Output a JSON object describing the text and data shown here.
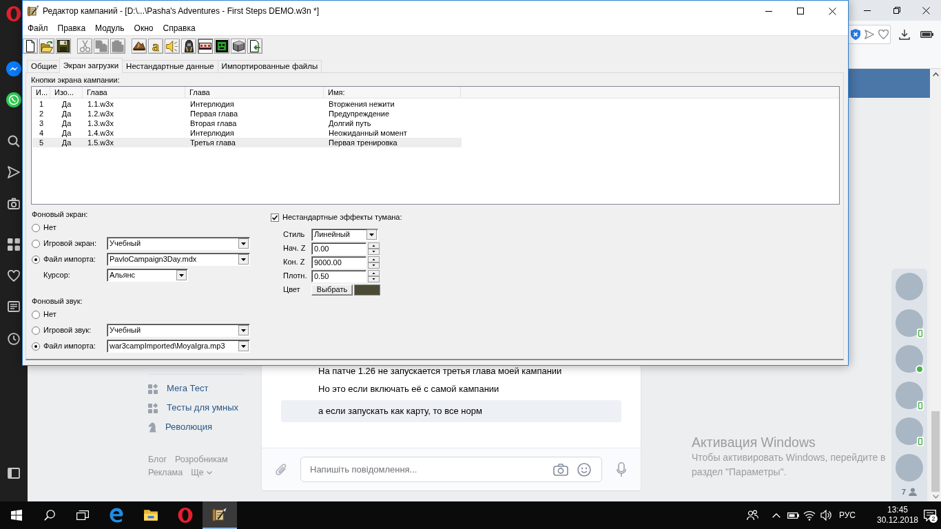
{
  "dialog": {
    "title": "Редактор кампаний - [D:\\...\\Pasha's Adventures - First Steps DEMO.w3n *]",
    "menu": [
      "Файл",
      "Правка",
      "Модуль",
      "Окно",
      "Справка"
    ],
    "toolbar": [
      [
        {
          "kind": "new",
          "disabled": false,
          "pressed": false
        },
        {
          "kind": "open",
          "disabled": false,
          "pressed": false
        },
        {
          "kind": "save",
          "disabled": false,
          "pressed": false
        }
      ],
      [
        {
          "kind": "cut",
          "disabled": true,
          "pressed": false
        },
        {
          "kind": "copy",
          "disabled": true,
          "pressed": false
        },
        {
          "kind": "paste",
          "disabled": true,
          "pressed": false
        }
      ],
      [
        {
          "kind": "terrain",
          "disabled": false,
          "pressed": false
        },
        {
          "kind": "glyph",
          "glyph": "a",
          "disabled": false,
          "pressed": false
        },
        {
          "kind": "sound",
          "disabled": false,
          "pressed": false
        },
        {
          "kind": "unit",
          "disabled": false,
          "pressed": false
        },
        {
          "kind": "screen",
          "disabled": false,
          "pressed": true
        },
        {
          "kind": "mask",
          "disabled": false,
          "pressed": false
        },
        {
          "kind": "cube",
          "disabled": false,
          "pressed": false
        },
        {
          "kind": "import",
          "disabled": false,
          "pressed": false
        }
      ]
    ],
    "tabs": [
      {
        "label": "Общие",
        "selected": false
      },
      {
        "label": "Экран загрузки",
        "selected": true
      },
      {
        "label": "Нестандартные данные",
        "selected": false
      },
      {
        "label": "Импортированные файлы",
        "selected": false
      }
    ],
    "campaign_buttons": {
      "label": "Кнопки экрана кампании:",
      "columns": [
        "И...",
        "Изо...",
        "Глава",
        "Глава",
        "Имя:"
      ],
      "rows": [
        {
          "cells": [
            "1",
            "Да",
            "1.1.w3x",
            "Интерлюдия",
            "Вторжения нежити"
          ],
          "selected": false
        },
        {
          "cells": [
            "2",
            "Да",
            "1.2.w3x",
            "Первая глава",
            "Предупреждение"
          ],
          "selected": false
        },
        {
          "cells": [
            "3",
            "Да",
            "1.3.w3x",
            "Вторая глава",
            "Долгий путь"
          ],
          "selected": false
        },
        {
          "cells": [
            "4",
            "Да",
            "1.4.w3x",
            "Интерлюдия",
            "Неожиданный момент"
          ],
          "selected": false
        },
        {
          "cells": [
            "5",
            "Да",
            "1.5.w3x",
            "Третья глава",
            "Первая тренировка"
          ],
          "selected": true
        }
      ]
    },
    "background_screen": {
      "label": "Фоновый экран:",
      "options": [
        {
          "label": "Нет",
          "selected": false
        },
        {
          "label": "Игровой экран:",
          "selected": false,
          "value": "Учебный"
        },
        {
          "label": "Файл импорта:",
          "selected": true,
          "value": "PavloCampaign3Day.mdx"
        }
      ],
      "cursor": {
        "label": "Курсор:",
        "value": "Альянс"
      }
    },
    "background_sound": {
      "label": "Фоновый звук:",
      "options": [
        {
          "label": "Нет",
          "selected": false
        },
        {
          "label": "Игровой звук:",
          "selected": false,
          "value": "Учебный"
        },
        {
          "label": "Файл импорта:",
          "selected": true,
          "value": "war3campImported\\MoyaIgra.mp3"
        }
      ]
    },
    "fog": {
      "label": "Нестандартные эффекты тумана:",
      "checked": true,
      "style": {
        "label": "Стиль",
        "value": "Линейный"
      },
      "fields": [
        {
          "label": "Нач. Z",
          "value": "0.00"
        },
        {
          "label": "Кон. Z",
          "value": "9000.00"
        },
        {
          "label": "Плотн.",
          "value": "0.50"
        }
      ],
      "color": {
        "label": "Цвет",
        "button": "Выбрать",
        "color": "#4c4a34"
      }
    }
  },
  "browser": {
    "page": {
      "menu": [
        {
          "label": "Мега Тест",
          "kind": "app"
        },
        {
          "label": "Тесты для умных",
          "kind": "app"
        },
        {
          "label": "Революция",
          "kind": "game"
        }
      ],
      "footer": [
        {
          "label": "Блог",
          "kind": "link"
        },
        {
          "label": "Розробникам",
          "kind": "link"
        },
        {
          "label": "Реклама",
          "kind": "link"
        },
        {
          "label": "Ще",
          "kind": "menu"
        }
      ],
      "messages": [
        {
          "text": "На патче 1.26 не запускается третья глава моей кампании",
          "selected": false
        },
        {
          "text": "Но это если включать её с самой кампании",
          "selected": false
        },
        {
          "text": "а если запускать как карту, то все норм",
          "selected": true
        }
      ],
      "composer": {
        "placeholder": "Напишіть повідомлення..."
      },
      "friends": [
        {
          "online_web": false,
          "online_mobile": false
        },
        {
          "online_web": false,
          "online_mobile": true
        },
        {
          "online_web": true,
          "online_mobile": false
        },
        {
          "online_web": false,
          "online_mobile": true
        },
        {
          "online_web": false,
          "online_mobile": true
        },
        {
          "online_web": false,
          "online_mobile": false
        }
      ],
      "friends_count": "7"
    }
  },
  "activation_notice": {
    "title": "Активация Windows",
    "text": "Чтобы активировать Windows, перейдите в раздел \"Параметры\"."
  },
  "taskbar": {
    "apps": [
      {
        "kind": "edge",
        "active": false
      },
      {
        "kind": "files",
        "active": false
      },
      {
        "kind": "opera",
        "active": false
      },
      {
        "kind": "editor",
        "active": true
      }
    ],
    "language": "РУС",
    "time": "13:45",
    "date": "30.12.2018",
    "notifications": "2"
  }
}
